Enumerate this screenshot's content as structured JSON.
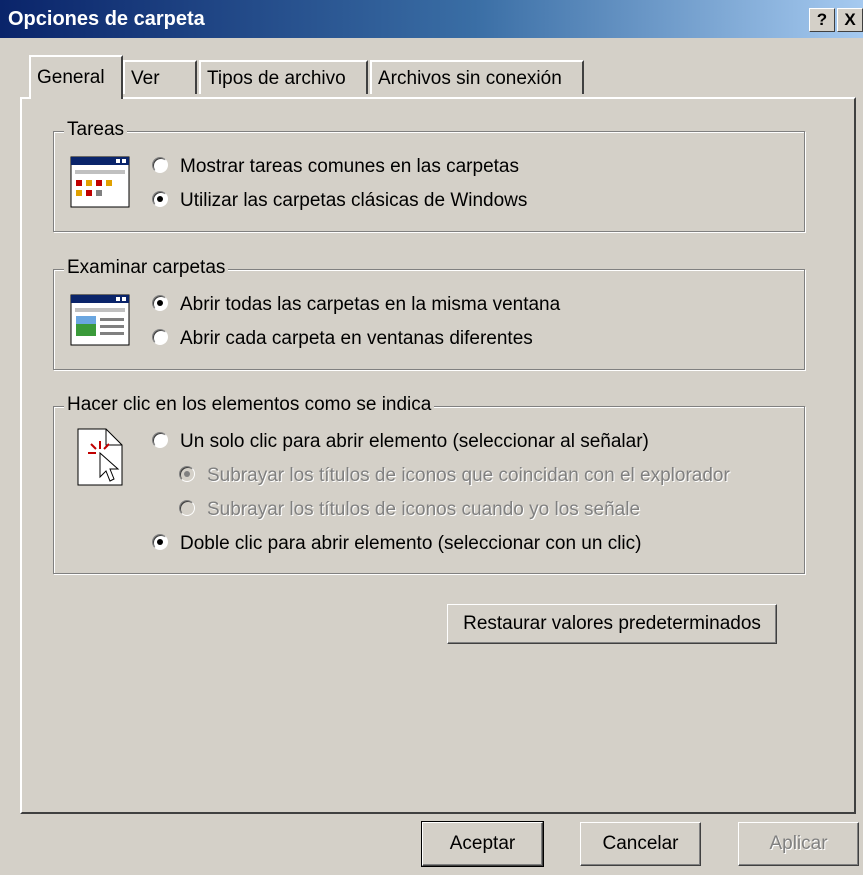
{
  "window": {
    "title": "Opciones de carpeta",
    "help_label": "?",
    "close_label": "X"
  },
  "tabs": [
    {
      "label": "General",
      "active": true
    },
    {
      "label": "Ver",
      "active": false
    },
    {
      "label": "Tipos de archivo",
      "active": false
    },
    {
      "label": "Archivos sin conexión",
      "active": false
    }
  ],
  "groups": {
    "tareas": {
      "title": "Tareas",
      "options": [
        {
          "label": "Mostrar tareas comunes en las carpetas",
          "checked": false
        },
        {
          "label": "Utilizar las carpetas clásicas de Windows",
          "checked": true
        }
      ]
    },
    "examinar": {
      "title": "Examinar carpetas",
      "options": [
        {
          "label": "Abrir todas las carpetas en la misma ventana",
          "checked": true
        },
        {
          "label": "Abrir cada carpeta en ventanas diferentes",
          "checked": false
        }
      ]
    },
    "clic": {
      "title": "Hacer clic en los elementos como se indica",
      "options": [
        {
          "label": "Un solo clic para abrir elemento (seleccionar al señalar)",
          "checked": false
        },
        {
          "label": "Subrayar los títulos de iconos que coincidan con el explorador",
          "checked": true,
          "disabled": true
        },
        {
          "label": "Subrayar los títulos de iconos cuando yo los señale",
          "checked": false,
          "disabled": true
        },
        {
          "label": "Doble clic para abrir elemento (seleccionar con un clic)",
          "checked": true
        }
      ]
    }
  },
  "restore_button": "Restaurar valores predeterminados",
  "footer": {
    "ok": "Aceptar",
    "cancel": "Cancelar",
    "apply": "Aplicar"
  },
  "icons": {
    "tareas": "task-folder-icon",
    "examinar": "browse-window-icon",
    "clic": "click-cursor-icon",
    "help": "help-icon",
    "close": "close-icon"
  }
}
